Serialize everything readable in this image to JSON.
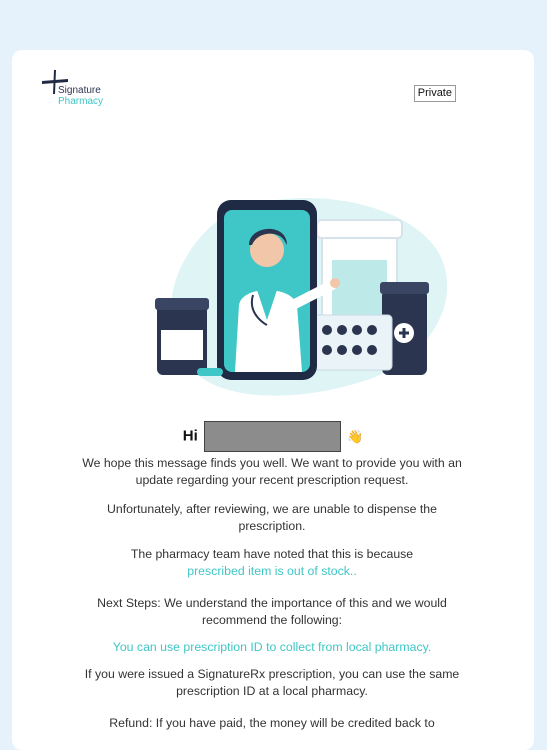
{
  "logo": {
    "line1": "Signature",
    "line2": "Pharmacy"
  },
  "private_label": "Private",
  "greeting": {
    "prefix": "Hi",
    "emoji": "👋"
  },
  "paragraphs": {
    "p1": "We hope this message finds you well. We want to provide you with an update regarding your recent prescription request.",
    "p2": "Unfortunately, after reviewing, we are unable to dispense the prescription.",
    "p3": "The pharmacy team have noted that this is because",
    "p3_reason": "prescribed item is out of stock..",
    "p4": "Next Steps: We understand the importance of this and we would recommend the following:",
    "p5": "You can use prescription ID to collect from local pharmacy.",
    "p6": "If you were issued a SignatureRx prescription, you can use the same prescription ID at a local pharmacy.",
    "p7": "Refund: If you have paid, the money will be credited back to"
  },
  "colors": {
    "accent": "#3fc6c6",
    "navy": "#2b3550",
    "background": "#e6f2fb"
  },
  "icons": {
    "logo_mark": "plus-cross-icon"
  }
}
